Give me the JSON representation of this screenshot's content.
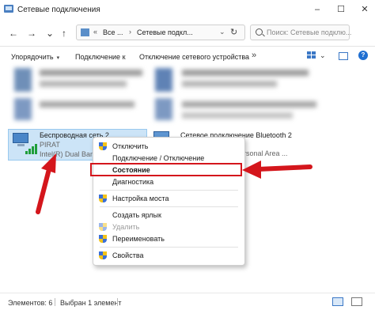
{
  "window": {
    "title": "Сетевые подключения",
    "controls": {
      "minimize": "–",
      "maximize": "☐",
      "close": "✕"
    }
  },
  "nav": {
    "back": "←",
    "forward": "→",
    "down": "⌄",
    "up": "↑",
    "address": {
      "overflow": "«",
      "segment1": "Все ...",
      "chevron": "›",
      "segment2": "Сетевые подкл...",
      "dropdown": "⌄",
      "refresh": "↻"
    },
    "search_placeholder": "Поиск: Сетевые подклю..."
  },
  "commands": {
    "organize": "Упорядочить",
    "connect_to": "Подключение к",
    "disable_device": "Отключение сетевого устройства",
    "more": "»",
    "view_dropdown": "⌄",
    "help": "?"
  },
  "items": {
    "wireless": {
      "name": "Беспроводная сеть 2",
      "network": "PIRAT",
      "device": "Intel(R) Dual Band"
    },
    "bluetooth": {
      "name": "Сетевое подключение Bluetooth 2",
      "device": "rsonal Area ..."
    }
  },
  "context_menu": {
    "disable": "Отключить",
    "connect_disconnect": "Подключение / Отключение",
    "status": "Состояние",
    "diagnostics": "Диагностика",
    "bridge": "Настройка моста",
    "shortcut": "Создать ярлык",
    "delete": "Удалить",
    "rename": "Переименовать",
    "properties": "Свойства"
  },
  "status_bar": {
    "elements": "Элементов: 6",
    "selected": "Выбран 1 элемент"
  },
  "colors": {
    "accent": "#1f6fd1",
    "selection": "#cce4f7",
    "annotation_red": "#d4161c"
  }
}
